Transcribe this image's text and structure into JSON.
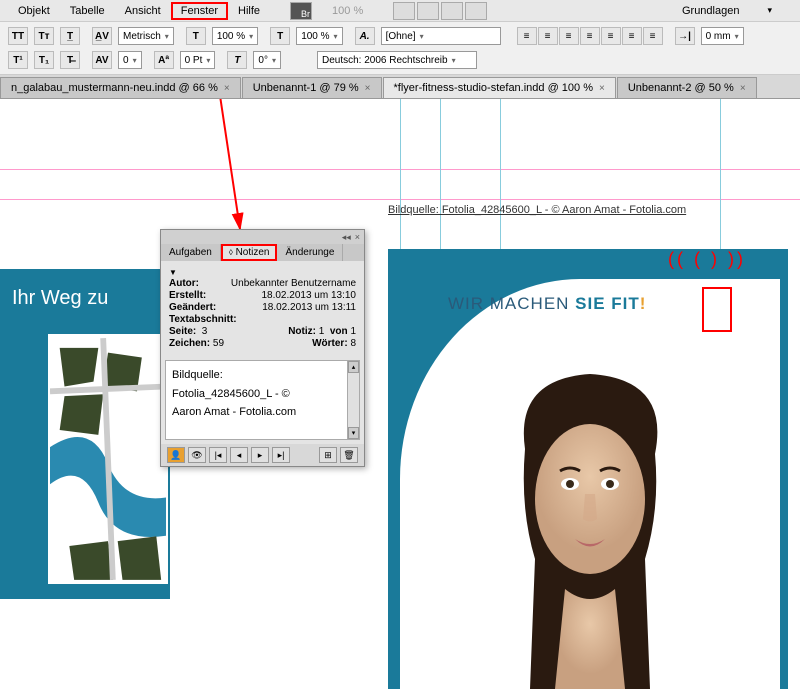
{
  "menu": {
    "items": [
      "Objekt",
      "Tabelle",
      "Ansicht",
      "Fenster",
      "Hilfe"
    ],
    "highlighted": 3,
    "zoom": "100 %",
    "right": "Grundlagen"
  },
  "toolbar": {
    "metric": "Metrisch",
    "pct1": "100 %",
    "pct2": "100 %",
    "ohne": "[Ohne]",
    "lang": "Deutsch: 2006 Rechtschreib",
    "pt": "0 Pt",
    "mm": "0 mm"
  },
  "tabs": [
    {
      "label": "n_galabau_mustermann-neu.indd @ 66 %"
    },
    {
      "label": "Unbenannt-1 @ 79 %"
    },
    {
      "label": "*flyer-fitness-studio-stefan.indd @ 100 %",
      "active": true
    },
    {
      "label": "Unbenannt-2 @ 50 %"
    }
  ],
  "leftdoc": {
    "title": "Ihr Weg zu"
  },
  "caption": "Bildquelle: Fotolia_42845600_L - © Aaron Amat - Fotolia.com",
  "headline": {
    "a": "WIR MACHEN ",
    "b": "SIE FIT",
    "c": "!"
  },
  "redmarks": "(( ( ) ))",
  "panel": {
    "tabs": [
      "Aufgaben",
      "Notizen",
      "Änderunge"
    ],
    "active": 1,
    "meta": {
      "author_l": "Autor:",
      "author_v": "Unbekannter Benutzername",
      "created_l": "Erstellt:",
      "created_v": "18.02.2013 um 13:10",
      "changed_l": "Geändert:",
      "changed_v": "18.02.2013 um 13:11",
      "section_l": "Textabschnitt:",
      "page_l": "Seite:",
      "page_v": "3",
      "note_l": "Notiz:",
      "note_v": "1",
      "of_l": "von",
      "of_v": "1",
      "chars_l": "Zeichen:",
      "chars_v": "59",
      "words_l": "Wörter:",
      "words_v": "8"
    },
    "content": "Bildquelle:\nFotolia_42845600_L - ©\nAaron Amat - Fotolia.com"
  }
}
